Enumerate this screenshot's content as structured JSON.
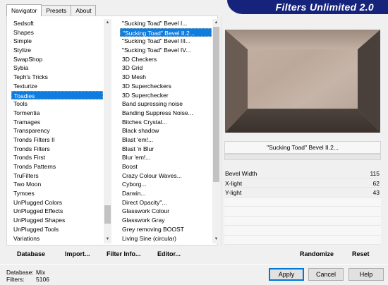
{
  "tabs": [
    "Navigator",
    "Presets",
    "About"
  ],
  "banner": "Filters Unlimited 2.0",
  "categories": [
    "Sedsoft",
    "Shapes",
    "Simple",
    "Stylize",
    "SwapShop",
    "Sybia",
    "Teph's Tricks",
    "Texturize",
    "Toadies",
    "Tools",
    "Tormentia",
    "Tramages",
    "Transparency",
    "Tronds Filters II",
    "Tronds Filters",
    "Tronds First",
    "Tronds Patterns",
    "TruFilters",
    "Two Moon",
    "Tymoes",
    "UnPlugged Colors",
    "UnPlugged Effects",
    "UnPlugged Shapes",
    "UnPlugged Tools",
    "Variations"
  ],
  "category_selected_index": 8,
  "filters": [
    "\"Sucking Toad\" Bevel I...",
    "\"Sucking Toad\" Bevel II.2...",
    "\"Sucking Toad\" Bevel III...",
    "\"Sucking Toad\" Bevel IV...",
    "3D Checkers",
    "3D Grid",
    "3D Mesh",
    "3D Supercheckers",
    "3D Superchecker",
    "Band supressing noise",
    "Banding Suppress Noise...",
    "Bitches Crystal...",
    "Black shadow",
    "Blast 'em!...",
    "Blast 'n Blur",
    "Blur 'em!...",
    "Boost",
    "Crazy Colour Waves...",
    "Cyborg...",
    "Darwin...",
    "Direct Opacity\"...",
    "Glasswork Colour",
    "Glasswork Gray",
    "Grey removing BOOST",
    "Living Sine (circular)"
  ],
  "filter_selected_index": 1,
  "left_buttons": {
    "database": "Database",
    "import": "Import...",
    "filter_info": "Filter Info...",
    "editor": "Editor..."
  },
  "right_buttons": {
    "randomize": "Randomize",
    "reset": "Reset"
  },
  "current_filter": "\"Sucking Toad\"  Bevel II.2...",
  "params": [
    {
      "name": "Bevel Width",
      "value": "115"
    },
    {
      "name": "X-light",
      "value": "62"
    },
    {
      "name": "Y-light",
      "value": "43"
    }
  ],
  "status": {
    "database_label": "Database:",
    "database_value": "Mix",
    "filters_label": "Filters:",
    "filters_value": "5106"
  },
  "dialog_buttons": {
    "apply": "Apply",
    "cancel": "Cancel",
    "help": "Help"
  },
  "colors": {
    "banner": "#16237a",
    "selection": "#0f7ce0"
  },
  "scroll": {
    "categories_position": 0.85,
    "filters_position": 0.0
  }
}
